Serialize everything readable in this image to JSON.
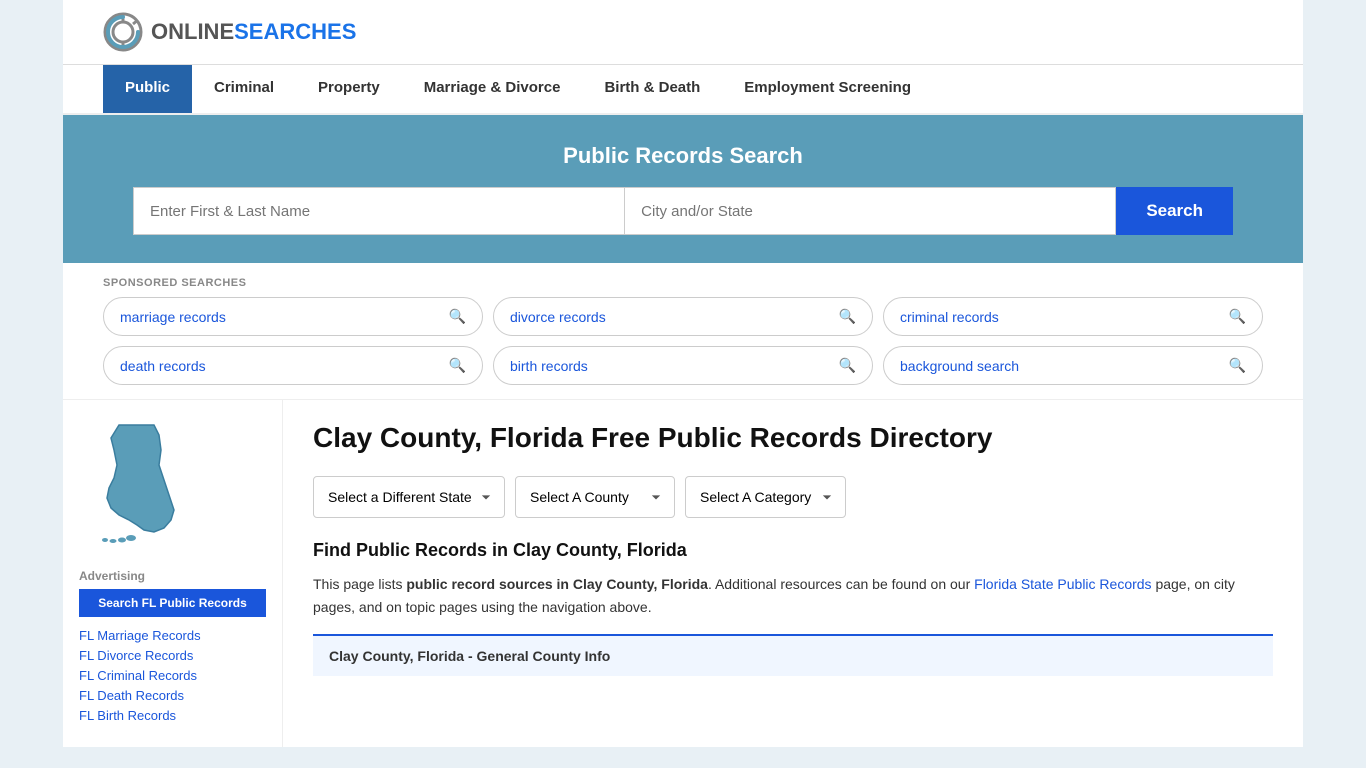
{
  "logo": {
    "online": "ONLINE",
    "searches": "SEARCHES"
  },
  "nav": {
    "items": [
      {
        "label": "Public",
        "active": true
      },
      {
        "label": "Criminal",
        "active": false
      },
      {
        "label": "Property",
        "active": false
      },
      {
        "label": "Marriage & Divorce",
        "active": false
      },
      {
        "label": "Birth & Death",
        "active": false
      },
      {
        "label": "Employment Screening",
        "active": false
      }
    ]
  },
  "search_banner": {
    "title": "Public Records Search",
    "name_placeholder": "Enter First & Last Name",
    "location_placeholder": "City and/or State",
    "button_label": "Search"
  },
  "sponsored": {
    "label": "SPONSORED SEARCHES",
    "items": [
      {
        "label": "marriage records"
      },
      {
        "label": "divorce records"
      },
      {
        "label": "criminal records"
      },
      {
        "label": "death records"
      },
      {
        "label": "birth records"
      },
      {
        "label": "background search"
      }
    ]
  },
  "page": {
    "title": "Clay County, Florida Free Public Records Directory",
    "dropdowns": {
      "state": "Select a Different State",
      "county": "Select A County",
      "category": "Select A Category"
    },
    "find_title": "Find Public Records in Clay County, Florida",
    "desc_part1": "This page lists ",
    "desc_bold": "public record sources in Clay County, Florida",
    "desc_part2": ". Additional resources can be found on our ",
    "desc_link_text": "Florida State Public Records",
    "desc_part3": " page, on city pages, and on topic pages using the navigation above.",
    "county_info_bar": "Clay County, Florida - General County Info"
  },
  "sidebar": {
    "ad_label": "Advertising",
    "ad_btn_label": "Search FL Public Records",
    "links": [
      {
        "label": "FL Marriage Records"
      },
      {
        "label": "FL Divorce Records"
      },
      {
        "label": "FL Criminal Records"
      },
      {
        "label": "FL Death Records"
      },
      {
        "label": "FL Birth Records"
      }
    ]
  },
  "colors": {
    "primary_blue": "#1a56db",
    "nav_active": "#2563a8",
    "banner_bg": "#5a9db8",
    "body_bg": "#e8f0f5"
  }
}
